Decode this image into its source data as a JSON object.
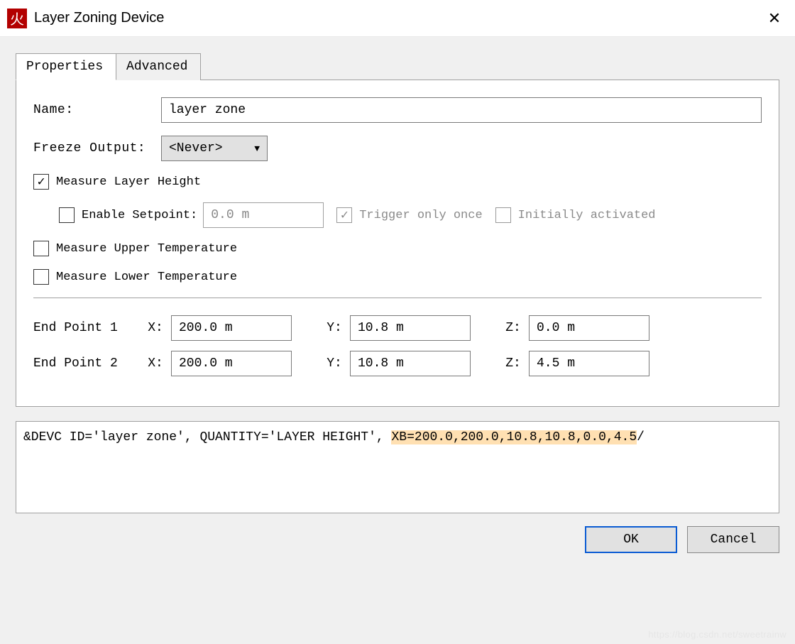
{
  "window": {
    "title": "Layer Zoning Device",
    "appicon_glyph": "火"
  },
  "tabs": {
    "properties": "Properties",
    "advanced": "Advanced"
  },
  "form": {
    "name_label": "Name:",
    "name_value": "layer zone",
    "freeze_label": "Freeze Output:",
    "freeze_value": "<Never>",
    "measure_layer_height_label": "Measure Layer Height",
    "measure_layer_height_checked": true,
    "enable_setpoint_label": "Enable Setpoint:",
    "enable_setpoint_checked": false,
    "setpoint_value": "0.0 m",
    "trigger_once_label": "Trigger only once",
    "trigger_once_checked": true,
    "initially_activated_label": "Initially activated",
    "initially_activated_checked": false,
    "measure_upper_temp_label": "Measure Upper Temperature",
    "measure_upper_temp_checked": false,
    "measure_lower_temp_label": "Measure Lower Temperature",
    "measure_lower_temp_checked": false,
    "endpoint1_label": "End Point 1",
    "endpoint2_label": "End Point 2",
    "x_label": "X:",
    "y_label": "Y:",
    "z_label": "Z:",
    "ep1": {
      "x": "200.0 m",
      "y": "10.8 m",
      "z": "0.0 m"
    },
    "ep2": {
      "x": "200.0 m",
      "y": "10.8 m",
      "z": "4.5 m"
    }
  },
  "code": {
    "prefix": "&DEVC ID='layer zone', QUANTITY='LAYER HEIGHT', ",
    "highlight": "XB=200.0,200.0,10.8,10.8,0.0,4.5",
    "suffix": "/"
  },
  "buttons": {
    "ok": "OK",
    "cancel": "Cancel"
  },
  "watermark": "https://blog.csdn.net/sweetrainw"
}
